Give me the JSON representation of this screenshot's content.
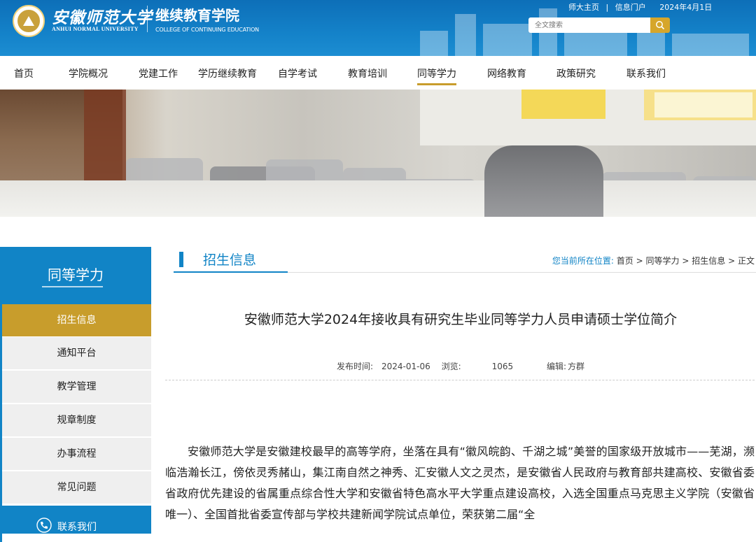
{
  "header": {
    "logo_cn": "安徽师范大学",
    "logo_en": "ANHUI NORMAL UNIVERSITY",
    "college_cn": "继续教育学院",
    "college_en": "COLLEGE OF CONTINUING EDUCATION",
    "links": [
      "师大主页",
      "信息门户"
    ],
    "separator": "|",
    "date": "2024年4月1日",
    "search_placeholder": "全文搜索",
    "colors": {
      "primary": "#1184c6",
      "accent": "#c89d2c"
    }
  },
  "nav": {
    "items": [
      "首页",
      "学院概况",
      "党建工作",
      "学历继续教育",
      "自学考试",
      "教育培训",
      "同等学力",
      "网络教育",
      "政策研究",
      "联系我们"
    ],
    "active": "同等学力"
  },
  "sidebar": {
    "title": "同等学力",
    "items": [
      "招生信息",
      "通知平台",
      "教学管理",
      "规章制度",
      "办事流程",
      "常见问题"
    ],
    "active": "招生信息",
    "contact": "联系我们"
  },
  "section": {
    "title": "招生信息",
    "breadcrumb_lead": "您当前所在位置:",
    "breadcrumb": [
      "首页",
      "同等学力",
      "招生信息",
      "正文"
    ],
    "breadcrumb_sep": ">"
  },
  "article": {
    "title": "安徽师范大学2024年接收具有研究生毕业同等学力人员申请硕士学位简介",
    "publish_label": "发布时间:",
    "publish_date": "2024-01-06",
    "views_label": "浏览:",
    "views": "1065",
    "editor_label": "编辑:",
    "editor": "方群",
    "body": "安徽师范大学是安徽建校最早的高等学府，坐落在具有“徽风皖韵、千湖之城”美誉的国家级开放城市——芜湖，濒临浩瀚长江，傍依灵秀赭山，集江南自然之神秀、汇安徽人文之灵杰，是安徽省人民政府与教育部共建高校、安徽省委省政府优先建设的省属重点综合性大学和安徽省特色高水平大学重点建设高校，入选全国重点马克思主义学院（安徽省唯一）、全国首批省委宣传部与学校共建新闻学院试点单位，荣获第二届“全"
  }
}
